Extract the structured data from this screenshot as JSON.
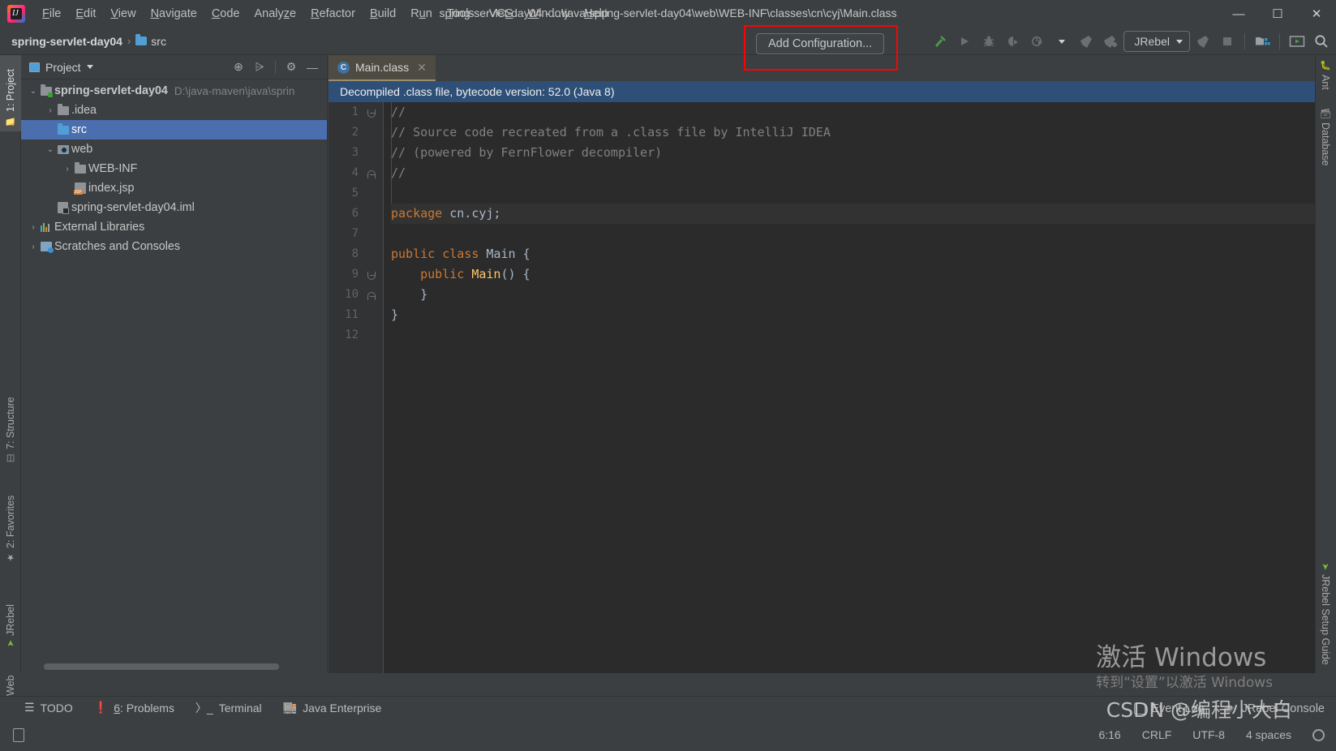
{
  "window": {
    "title": "spring-servlet-day04 - ...\\java\\spring-servlet-day04\\web\\WEB-INF\\classes\\cn\\cyj\\Main.class",
    "minimize": "—",
    "maximize": "☐",
    "close": "✕"
  },
  "menubar": {
    "items": [
      {
        "label": "File"
      },
      {
        "label": "Edit"
      },
      {
        "label": "View"
      },
      {
        "label": "Navigate"
      },
      {
        "label": "Code"
      },
      {
        "label": "Analyze"
      },
      {
        "label": "Refactor"
      },
      {
        "label": "Build"
      },
      {
        "label": "Run"
      },
      {
        "label": "Tools"
      },
      {
        "label": "VCS"
      },
      {
        "label": "Window"
      },
      {
        "label": "Help"
      }
    ]
  },
  "navbar": {
    "crumbs": [
      {
        "label": "spring-servlet-day04"
      },
      {
        "label": "src"
      }
    ],
    "separator": "›"
  },
  "toolbar": {
    "add_configuration_label": "Add Configuration...",
    "jrebel_label": "JRebel",
    "highlight_color": "#ff0000",
    "icons": [
      {
        "name": "build-hammer-icon"
      },
      {
        "name": "run-icon"
      },
      {
        "name": "debug-icon"
      },
      {
        "name": "run-with-coverage-icon"
      },
      {
        "name": "profile-icon"
      },
      {
        "name": "jrebel-run-icon"
      },
      {
        "name": "jrebel-debug-icon"
      },
      {
        "name": "jrebel-run-2-icon"
      },
      {
        "name": "stop-icon"
      },
      {
        "name": "project-structure-icon"
      },
      {
        "name": "presentation-icon"
      },
      {
        "name": "search-everywhere-icon"
      }
    ]
  },
  "left_strip": {
    "tabs": [
      {
        "label": "1: Project",
        "active": true
      },
      {
        "label": "7: Structure",
        "active": false
      },
      {
        "label": "2: Favorites",
        "active": false
      },
      {
        "label": "JRebel",
        "active": false
      },
      {
        "label": "Web",
        "active": false
      }
    ]
  },
  "right_strip": {
    "tabs": [
      {
        "label": "Ant"
      },
      {
        "label": "Database"
      },
      {
        "label": "JRebel Setup Guide"
      }
    ]
  },
  "project_panel": {
    "title": "Project",
    "dropdown_caret": "▾",
    "tools": [
      {
        "name": "locate-icon",
        "glyph": "⊕"
      },
      {
        "name": "collapse-all-icon",
        "glyph": "⩥"
      },
      {
        "name": "settings-gear-icon",
        "glyph": "⚙"
      },
      {
        "name": "hide-panel-icon",
        "glyph": "—"
      }
    ],
    "tree": [
      {
        "label": "spring-servlet-day04",
        "sub": "D:\\java-maven\\java\\sprin",
        "arrow": "⌄",
        "icon": "module-icon",
        "indent": 0,
        "bold": true,
        "selected": false
      },
      {
        "label": ".idea",
        "sub": "",
        "arrow": "›",
        "icon": "folder-gray-icon",
        "indent": 1,
        "bold": false,
        "selected": false
      },
      {
        "label": "src",
        "sub": "",
        "arrow": "",
        "icon": "folder-blue-icon",
        "indent": 1,
        "bold": false,
        "selected": true
      },
      {
        "label": "web",
        "sub": "",
        "arrow": "⌄",
        "icon": "web-folder-icon",
        "indent": 1,
        "bold": false,
        "selected": false
      },
      {
        "label": "WEB-INF",
        "sub": "",
        "arrow": "›",
        "icon": "folder-gray-icon",
        "indent": 2,
        "bold": false,
        "selected": false
      },
      {
        "label": "index.jsp",
        "sub": "",
        "arrow": "",
        "icon": "jsp-file-icon",
        "indent": 2,
        "bold": false,
        "selected": false
      },
      {
        "label": "spring-servlet-day04.iml",
        "sub": "",
        "arrow": "",
        "icon": "iml-file-icon",
        "indent": 1,
        "bold": false,
        "selected": false
      },
      {
        "label": "External Libraries",
        "sub": "",
        "arrow": "›",
        "icon": "libraries-icon",
        "indent": 0,
        "bold": false,
        "selected": false
      },
      {
        "label": "Scratches and Consoles",
        "sub": "",
        "arrow": "›",
        "icon": "scratches-icon",
        "indent": 0,
        "bold": false,
        "selected": false
      }
    ]
  },
  "editor": {
    "tab": {
      "label": "Main.class",
      "icon_letter": "C",
      "close_glyph": "✕"
    },
    "banner": "Decompiled .class file, bytecode version: 52.0 (Java 8)",
    "lines": [
      {
        "n": "1",
        "text": "//",
        "kind": "comment",
        "current": false
      },
      {
        "n": "2",
        "text": "// Source code recreated from a .class file by IntelliJ IDEA",
        "kind": "comment",
        "current": false
      },
      {
        "n": "3",
        "text": "// (powered by FernFlower decompiler)",
        "kind": "comment",
        "current": false
      },
      {
        "n": "4",
        "text": "//",
        "kind": "comment",
        "current": false
      },
      {
        "n": "5",
        "text": "",
        "kind": "plain",
        "current": false
      },
      {
        "n": "6",
        "text": "package cn.cyj;",
        "kind": "package",
        "current": true
      },
      {
        "n": "7",
        "text": "",
        "kind": "plain",
        "current": false
      },
      {
        "n": "8",
        "text": "public class Main {",
        "kind": "classdecl",
        "current": false
      },
      {
        "n": "9",
        "text": "    public Main() {",
        "kind": "ctor",
        "current": false
      },
      {
        "n": "10",
        "text": "    }",
        "kind": "plain",
        "current": false
      },
      {
        "n": "11",
        "text": "}",
        "kind": "plain",
        "current": false
      },
      {
        "n": "12",
        "text": "",
        "kind": "plain",
        "current": false
      }
    ]
  },
  "bottom_bar": {
    "items": [
      {
        "label": "TODO",
        "icon": "todo-icon"
      },
      {
        "label": "6: Problems",
        "icon": "problems-icon"
      },
      {
        "label": "Terminal",
        "icon": "terminal-icon"
      },
      {
        "label": "Java Enterprise",
        "icon": "java-enterprise-icon"
      }
    ]
  },
  "status_bar": {
    "caret": "6:16",
    "line_separator": "CRLF",
    "encoding": "UTF-8",
    "indent": "4 spaces",
    "event_log": "Event Log",
    "jrebel_console": "JRebel Console"
  },
  "watermark": {
    "line1": "激活 Windows",
    "line2": "转到“设置”以激活 Windows",
    "csdn": "CSDN @编程小大白"
  }
}
